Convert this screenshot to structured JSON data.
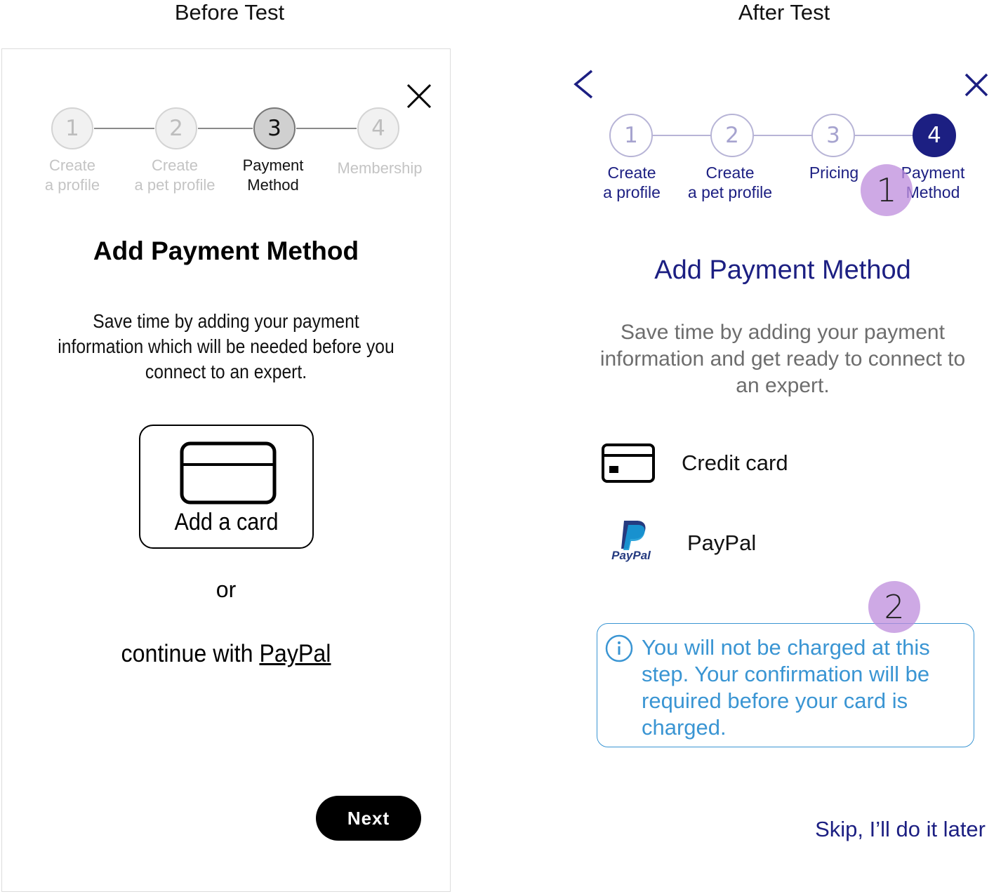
{
  "captions": {
    "before": "Before Test",
    "after": "After Test"
  },
  "before": {
    "steps": [
      {
        "number": "1",
        "label_line1": "Create",
        "label_line2": "a profile"
      },
      {
        "number": "2",
        "label_line1": "Create",
        "label_line2": "a pet profile"
      },
      {
        "number": "3",
        "label_line1": "Payment",
        "label_line2": "Method"
      },
      {
        "number": "4",
        "label_line1": "Membership",
        "label_line2": ""
      }
    ],
    "active_step": 3,
    "title": "Add Payment Method",
    "description": "Save time by adding your payment information which will be needed before you connect to an expert.",
    "add_card_label": "Add a card",
    "or_text": "or",
    "continue_text": "continue with",
    "paypal_link": "PayPal",
    "next_label": "Next",
    "icons": {
      "close": "close-icon",
      "card": "credit-card-icon"
    }
  },
  "after": {
    "steps": [
      {
        "number": "1",
        "label_line1": "Create",
        "label_line2": "a profile"
      },
      {
        "number": "2",
        "label_line1": "Create",
        "label_line2": "a pet profile"
      },
      {
        "number": "3",
        "label_line1": "Pricing",
        "label_line2": ""
      },
      {
        "number": "4",
        "label_line1": "Payment",
        "label_line2": "Method"
      }
    ],
    "active_step": 4,
    "title": "Add Payment Method",
    "description": "Save time by adding your payment information and get ready to connect to an expert.",
    "options": [
      {
        "label": "Credit card",
        "icon": "credit-card-icon"
      },
      {
        "label": "PayPal",
        "icon": "paypal-logo-icon"
      }
    ],
    "paypal_logo_text": "PayPal",
    "info_text": "You will not be charged at this step. Your confirmation will be required before your card is charged.",
    "skip_label": "Skip, I’ll do it later",
    "markers": [
      "1",
      "2"
    ],
    "icons": {
      "back": "back-chevron-icon",
      "close": "close-icon",
      "info": "info-icon"
    }
  },
  "colors": {
    "after_primary": "#1c1f82",
    "after_step_inactive": "#b7b4d6",
    "info_blue": "#3a95d3",
    "marker": "#c08fdf",
    "before_primary": "#000000"
  }
}
